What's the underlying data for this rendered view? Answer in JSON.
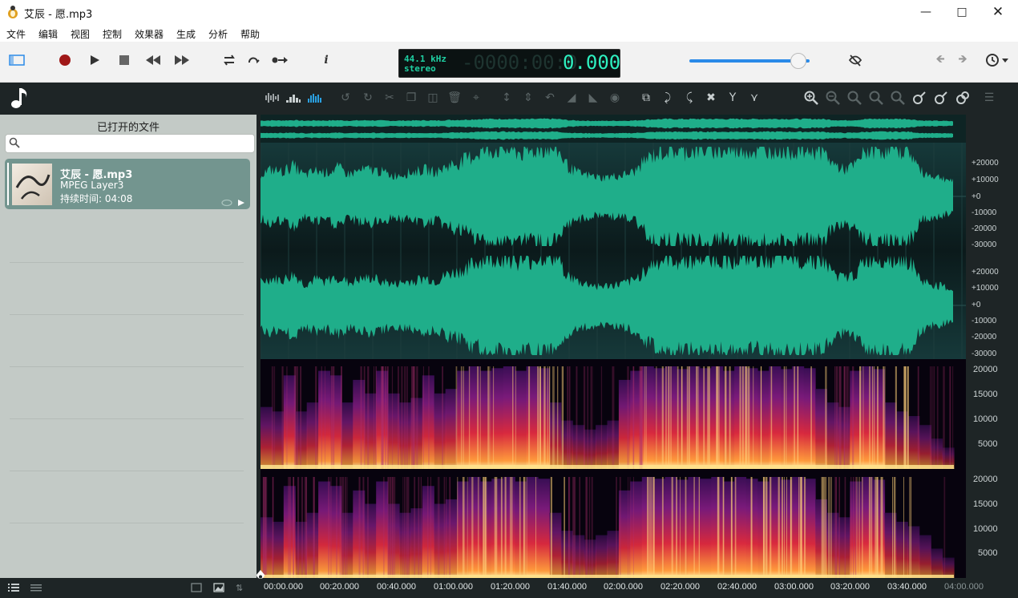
{
  "window": {
    "title": "艾辰 - 愿.mp3",
    "icons": [
      "app-icon",
      "minimize-icon",
      "maximize-icon",
      "close-icon"
    ]
  },
  "menu": [
    "文件",
    "编辑",
    "视图",
    "控制",
    "效果器",
    "生成",
    "分析",
    "帮助"
  ],
  "toolbar": {
    "info_glyph": "i",
    "icons": [
      "sidebar-toggle-icon",
      "record-icon",
      "play-icon",
      "stop-icon",
      "rewind-icon",
      "fast-forward-icon",
      "loop-icon",
      "repeat-icon",
      "skip-icon",
      "info-icon",
      "mute-icon",
      "back-arrow-icon",
      "forward-arrow-icon",
      "history-icon"
    ]
  },
  "display": {
    "sample_rate": "44.1 kHz",
    "channels": "stereo",
    "time_ghost": "-0000:00:0",
    "time": "0.000",
    "volume": 0.9
  },
  "accent_colors": {
    "waveform": "#1fae8a",
    "lcd": "#2ef0c0",
    "card": "#73958f",
    "volume": "#2a8ae8"
  },
  "sidebar": {
    "heading": "已打开的文件",
    "search_placeholder": "",
    "files": [
      {
        "name": "艾辰 - 愿.mp3",
        "format": "MPEG Layer3",
        "duration": "持续时间: 04:08"
      }
    ]
  },
  "amplitude_ticks": [
    "+20000",
    "+10000",
    "+0",
    "-10000",
    "-20000",
    "-30000"
  ],
  "frequency_ticks": [
    "20000",
    "15000",
    "10000",
    "5000"
  ],
  "timeline": [
    "00:00.000",
    "00:20.000",
    "00:40.000",
    "01:00.000",
    "01:20.000",
    "01:40.000",
    "02:00.000",
    "02:20.000",
    "02:40.000",
    "03:00.000",
    "03:20.000",
    "03:40.000",
    "04:00.000"
  ],
  "envelope": [
    0.35,
    0.45,
    0.4,
    0.55,
    0.3,
    0.42,
    0.38,
    0.5,
    0.34,
    0.42,
    0.46,
    0.4,
    0.3,
    0.35,
    0.4,
    0.45,
    0.38,
    0.55,
    0.62,
    0.75,
    0.9,
    0.95,
    0.98,
    0.92,
    0.85,
    0.95,
    1.0,
    0.95,
    0.5,
    0.35,
    0.3,
    0.25,
    0.28,
    0.32,
    0.4,
    0.7,
    0.85,
    0.95,
    0.9,
    0.92,
    0.95,
    0.98,
    0.9,
    0.95,
    0.97,
    0.9,
    0.96,
    0.98,
    0.95,
    0.92,
    0.96,
    0.93,
    0.6,
    0.45,
    0.55,
    0.92,
    0.97,
    0.95,
    1.0,
    0.9,
    0.4,
    0.3,
    0.25,
    0.15
  ],
  "spectrum_energy": [
    0.55,
    0.5,
    0.9,
    0.5,
    0.6,
    0.95,
    0.9,
    0.6,
    0.85,
    0.7,
    0.95,
    0.7,
    0.6,
    0.65,
    0.9,
    0.7,
    0.75,
    0.95,
    1.0,
    0.95,
    0.98,
    1.0,
    0.95,
    1.0,
    0.98,
    0.6,
    0.4,
    0.35,
    0.3,
    0.35,
    0.4,
    0.85,
    0.95,
    1.0,
    0.98,
    1.0,
    0.97,
    1.0,
    0.98,
    1.0,
    0.95,
    1.0,
    0.98,
    0.95,
    1.0,
    0.97,
    1.0,
    0.98,
    0.75,
    0.6,
    0.55,
    0.95,
    1.0,
    0.97,
    0.6,
    0.5,
    0.45,
    0.35,
    0.2,
    0.1
  ]
}
